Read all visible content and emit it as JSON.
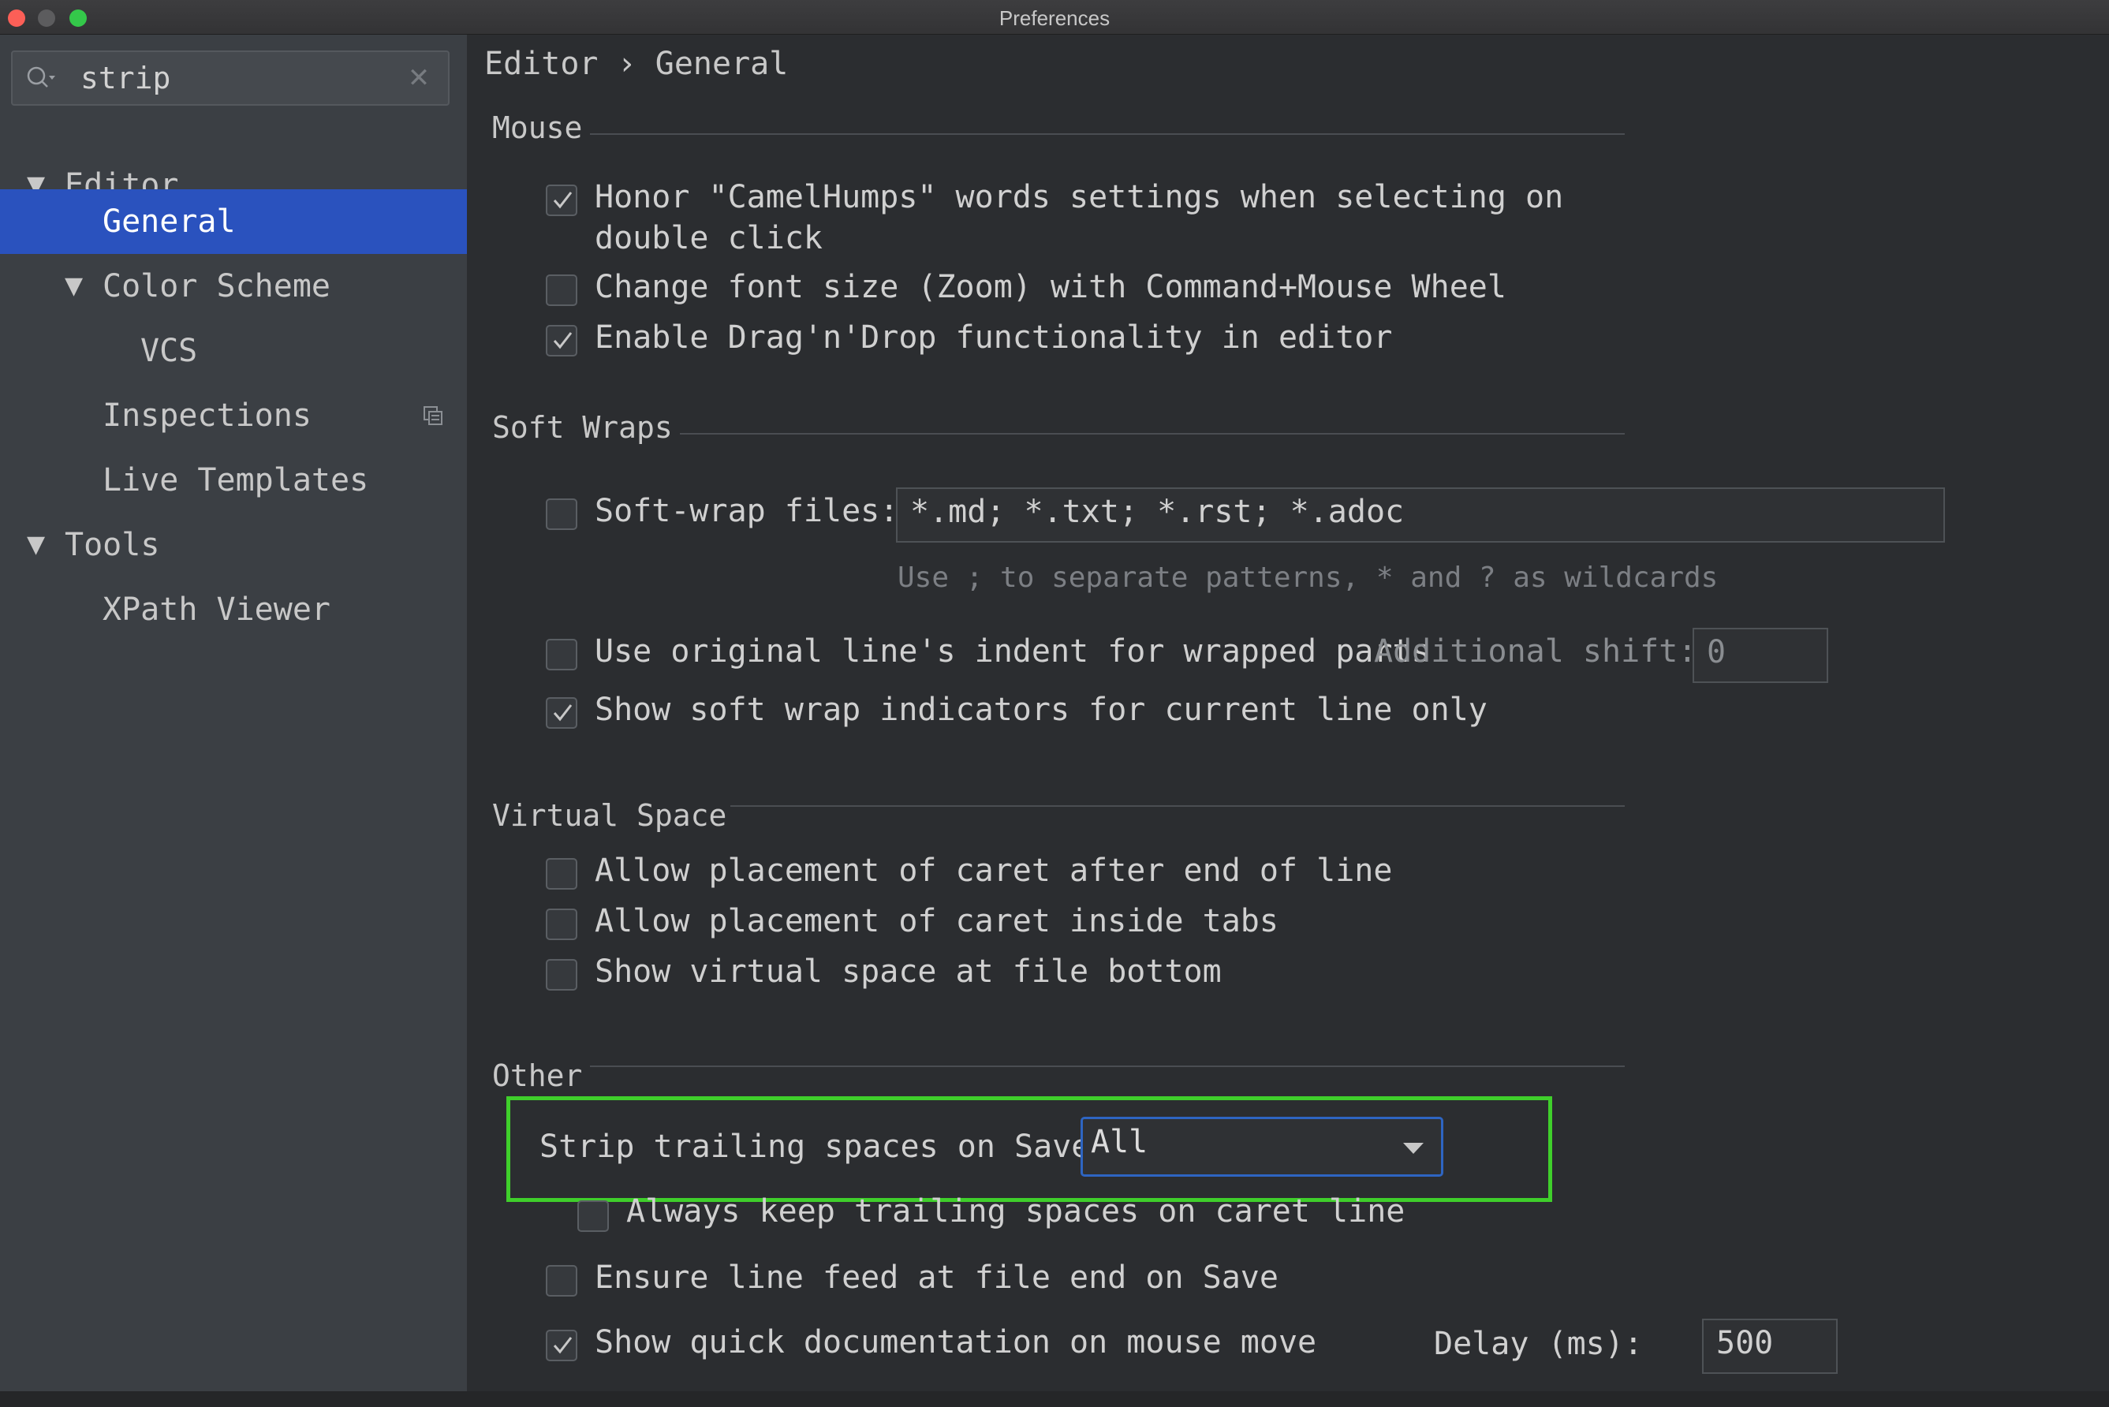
{
  "window": {
    "title": "Preferences"
  },
  "search": {
    "value": "strip",
    "clear_symbol": "✕"
  },
  "sidebar": {
    "items": [
      {
        "label": "Editor",
        "expanded": true
      },
      {
        "label": "General",
        "selected": true
      },
      {
        "label": "Color Scheme",
        "expanded": true
      },
      {
        "label": "VCS"
      },
      {
        "label": "Inspections"
      },
      {
        "label": "Live Templates"
      },
      {
        "label": "Tools",
        "expanded": true
      },
      {
        "label": "XPath Viewer"
      }
    ]
  },
  "breadcrumb": {
    "text": "Editor › General"
  },
  "sections": {
    "mouse": {
      "title": "Mouse",
      "options": [
        {
          "label": "Honor \"CamelHumps\" words settings when selecting on",
          "label_line2": "double click",
          "checked": true
        },
        {
          "label": "Change font size (Zoom) with Command+Mouse Wheel",
          "checked": false
        },
        {
          "label": "Enable Drag'n'Drop functionality in editor",
          "checked": true
        }
      ]
    },
    "soft_wraps": {
      "title": "Soft Wraps",
      "soft_wrap_files": {
        "label": "Soft-wrap files:",
        "value": "*.md; *.txt; *.rst; *.adoc",
        "checked": false
      },
      "hint": "Use ; to separate patterns, * and ? as wildcards",
      "indent": {
        "label": "Use original line's indent for wrapped parts",
        "shift_label": "Additional shift:",
        "shift_value": "0",
        "checked": false
      },
      "indicators": {
        "label": "Show soft wrap indicators for current line only",
        "checked": true
      }
    },
    "virtual_space": {
      "title": "Virtual Space",
      "options": [
        {
          "label": "Allow placement of caret after end of line",
          "checked": false
        },
        {
          "label": "Allow placement of caret inside tabs",
          "checked": false
        },
        {
          "label": "Show virtual space at file bottom",
          "checked": false
        }
      ]
    },
    "other": {
      "title": "Other",
      "strip": {
        "label": "Strip trailing spaces on Save:",
        "value": "All"
      },
      "keep_trailing": {
        "label": "Always keep trailing spaces on caret line",
        "checked": false
      },
      "line_feed": {
        "label": "Ensure line feed at file end on Save",
        "checked": false
      },
      "quick_doc": {
        "label": "Show quick documentation on mouse move",
        "checked": true,
        "delay_label": "Delay (ms):",
        "delay_value": "500"
      }
    }
  },
  "colors": {
    "selection": "#2a52be",
    "highlight_box": "#3fcf2b",
    "dropdown_focus": "#2e65c2"
  }
}
